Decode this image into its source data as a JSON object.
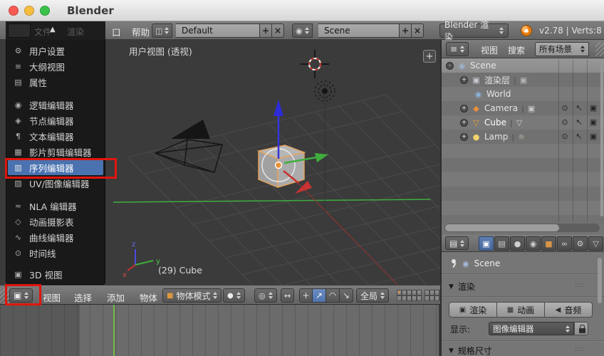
{
  "window": {
    "title": "Blender"
  },
  "topbar": {
    "covered": {
      "file": "文件",
      "render": "渲染",
      "scroll_up": "▲"
    },
    "window_partial": "口",
    "help": "帮助",
    "layout_value": "Default",
    "scene_value": "Scene",
    "engine_value": "Blender 渲染",
    "version": "v2.78 | Verts:8 |",
    "add": "+",
    "close": "×"
  },
  "editor_menu": {
    "items": [
      {
        "label": "用户设置"
      },
      {
        "label": "大纲视图"
      },
      {
        "label": "属性"
      },
      {
        "label": "逻辑编辑器"
      },
      {
        "label": "节点编辑器"
      },
      {
        "label": "文本编辑器"
      },
      {
        "label": "影片剪辑编辑器"
      },
      {
        "label": "序列编辑器"
      },
      {
        "label": "UV/图像编辑器"
      },
      {
        "label": "NLA 编辑器"
      },
      {
        "label": "动画摄影表"
      },
      {
        "label": "曲线编辑器"
      },
      {
        "label": "时间线"
      },
      {
        "label": "3D 视图"
      }
    ]
  },
  "viewport": {
    "view_label": "用户视图 (透视)",
    "object_label": "(29) Cube",
    "plus": "+",
    "axis_z": "z",
    "axis_y": "y",
    "axis_x": "x"
  },
  "view3d_header": {
    "menu_view": "视图",
    "menu_select": "选择",
    "menu_add": "添加",
    "menu_object": "物体",
    "mode": "物体模式",
    "orientation": "全局"
  },
  "outliner": {
    "menu_view": "视图",
    "menu_search": "搜索",
    "filter": "所有场景",
    "rows": [
      {
        "label": "Scene"
      },
      {
        "label": "渲染层"
      },
      {
        "label": "World"
      },
      {
        "label": "Camera"
      },
      {
        "label": "Cube"
      },
      {
        "label": "Lamp"
      }
    ]
  },
  "properties": {
    "context": "Scene",
    "section_render": "渲染",
    "btn_render": "渲染",
    "btn_animation": "动画",
    "btn_audio": "音频",
    "display_label": "显示:",
    "display_value": "图像编辑器",
    "section_dimensions": "规格尺寸",
    "collapse_arrow": "▼",
    "drag_dots": "∷∷"
  },
  "icons": {
    "user_settings": "⚙",
    "outliner_tree": "≡",
    "properties_panel": "▤",
    "logic": "◉",
    "node": "◈",
    "text_editor": "¶",
    "movie_clip": "▦",
    "sequencer": "▥",
    "uv_image": "▨",
    "nla": "≈",
    "dope": "◇",
    "graph": "∿",
    "timeline": "⊙",
    "view3d": "▣",
    "layout_screen": "◫",
    "scene_data": "◉",
    "editor_cube": "▣",
    "mode_cube": "■",
    "shading_sphere": "●",
    "pivot": "◎",
    "center_points": "↔",
    "manip_axes": "+",
    "manip_translate": "↗",
    "manip_rotate": "◠",
    "manip_scale": "↘",
    "expander_open": "-",
    "expander_closed": "+",
    "pipe": "|",
    "scene_icon": "◉",
    "renderlayer": "▣",
    "world": "◉",
    "camera_obj": "◆",
    "mesh_tri": "▽",
    "lamp_dot": "●",
    "sun": "☼",
    "eye": "⊙",
    "cursor_arrow": "↖",
    "cam_restrict": "▣",
    "tab_render": "▣",
    "tab_layers": "▤",
    "tab_scene": "●",
    "tab_world": "◉",
    "tab_object": "■",
    "tab_constraints": "∞",
    "tab_modifiers": "⚙",
    "tab_data": "▽",
    "tab_material": "◐",
    "btn_cam": "▣",
    "btn_clap": "▦",
    "btn_audio": "◀"
  },
  "colors": {
    "annotation_red": "#e1150d",
    "menu_selection_blue": "#4a72b0",
    "active_tab_blue": "#4e74ad",
    "axis_x_red": "#c83232",
    "axis_y_green": "#3fae3f",
    "axis_z_blue": "#3535d8",
    "selected_object_orange": "#f5a623",
    "playhead_green": "#6fbe45"
  }
}
